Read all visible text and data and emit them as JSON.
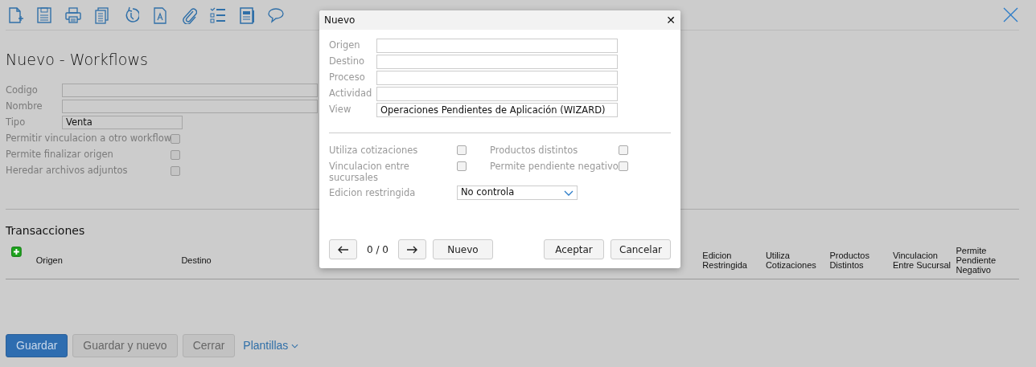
{
  "toolbar": {
    "icons": [
      {
        "kind": "new"
      },
      {
        "kind": "save"
      },
      {
        "kind": "print"
      },
      {
        "kind": "copy"
      },
      {
        "kind": "history"
      },
      {
        "kind": "document"
      },
      {
        "kind": "attach"
      },
      {
        "kind": "checklist"
      },
      {
        "kind": "report"
      },
      {
        "kind": "comment"
      }
    ]
  },
  "page_title": "Nuevo - Workflows",
  "form": {
    "fields": [
      {
        "label": "Codigo"
      },
      {
        "label": "Nombre"
      },
      {
        "label": "Tipo",
        "value": "Venta"
      }
    ],
    "checkboxes": [
      {
        "label": "Permitir vinculacion a otro workflow",
        "checked": false
      },
      {
        "label": "Permite finalizar origen",
        "checked": false
      },
      {
        "label": "Heredar archivos adjuntos",
        "checked": false
      }
    ]
  },
  "transactions": {
    "title": "Transacciones",
    "columns": [
      {
        "label": "Origen"
      },
      {
        "label": "Destino"
      },
      {
        "label": "Edicion Restringida"
      },
      {
        "label": "Utiliza Cotizaciones"
      },
      {
        "label": "Productos Distintos"
      },
      {
        "label": "Vinculacion Entre Sucursal"
      },
      {
        "label": "Permite Pendiente Negativo"
      }
    ]
  },
  "buttons": [
    {
      "label": "Guardar",
      "kind": "primary"
    },
    {
      "label": "Guardar y nuevo",
      "kind": "secondary"
    },
    {
      "label": "Cerrar",
      "kind": "secondary"
    },
    {
      "label": "Plantillas",
      "kind": "dropdown-link"
    }
  ],
  "dialog": {
    "title": "Nuevo",
    "close": "✕",
    "fields": [
      {
        "label": "Origen"
      },
      {
        "label": "Destino"
      },
      {
        "label": "Proceso"
      },
      {
        "label": "Actividad"
      },
      {
        "label": "View",
        "value": "Operaciones Pendientes de Aplicación (WIZARD)"
      }
    ],
    "checkboxes": [
      {
        "label": "Utiliza cotizaciones",
        "checked": false
      },
      {
        "label": "Productos distintos",
        "checked": false
      },
      {
        "label": "Vinculacion entre sucursales",
        "checked": false
      },
      {
        "label": "Permite pendiente negativo",
        "checked": false
      }
    ],
    "select": {
      "label": "Edicion restringida",
      "value": "No controla"
    },
    "pager": "0 / 0",
    "buttons": [
      {
        "label": "Nuevo"
      },
      {
        "label": "Aceptar"
      },
      {
        "label": "Cancelar"
      }
    ]
  }
}
